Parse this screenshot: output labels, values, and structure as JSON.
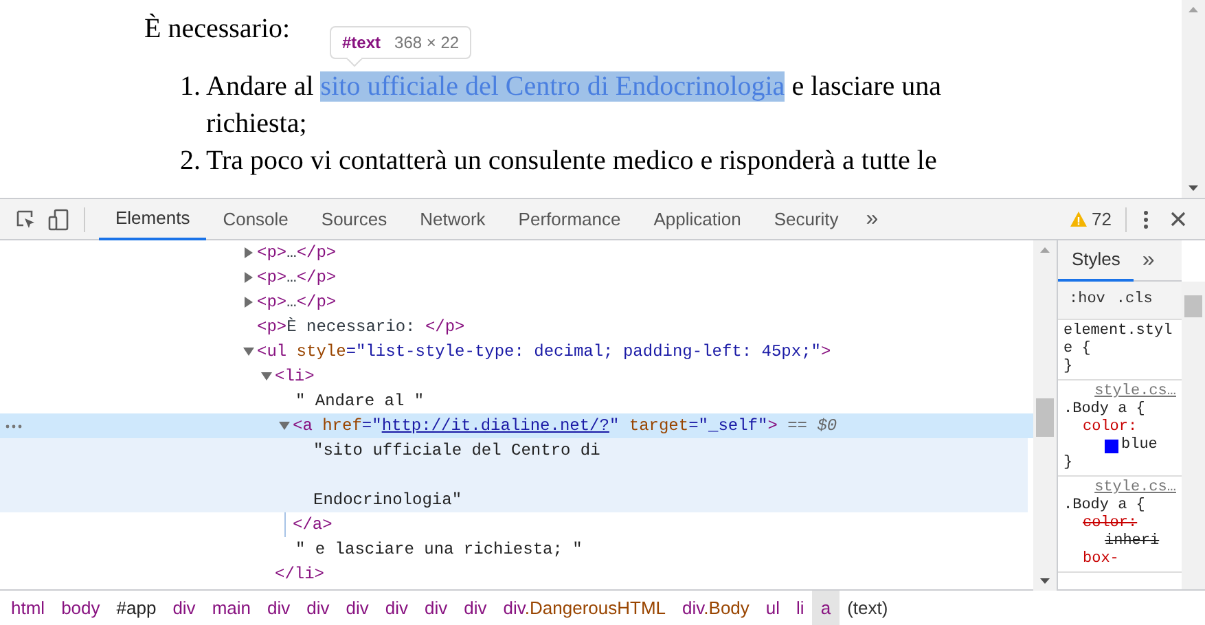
{
  "page": {
    "heading": "È necessario:",
    "list": [
      {
        "number": "1.",
        "before": "Andare al ",
        "link": "sito ufficiale del Centro di Endocrinologia",
        "highlighted": true,
        "after": " e lasciare una richiesta;"
      },
      {
        "number": "2.",
        "before": "Tra poco vi contatterà un consulente medico e risponderà a tutte le"
      }
    ],
    "tooltip": {
      "node": "#text",
      "size": "368 × 22"
    }
  },
  "toolbar": {
    "tabs": [
      {
        "label": "Elements",
        "selected": true
      },
      {
        "label": "Console",
        "selected": false
      },
      {
        "label": "Sources",
        "selected": false
      },
      {
        "label": "Network",
        "selected": false
      },
      {
        "label": "Performance",
        "selected": false
      },
      {
        "label": "Application",
        "selected": false
      },
      {
        "label": "Security",
        "selected": false
      }
    ],
    "more": "»",
    "warnings": "72"
  },
  "dom_tree": [
    {
      "kind": "element",
      "selected": false,
      "expanded": false,
      "tokens": [
        {
          "kind": "tag",
          "text": "<p>"
        },
        {
          "kind": "text",
          "text": "…"
        },
        {
          "kind": "tag",
          "text": "</p>"
        }
      ]
    },
    {
      "kind": "element",
      "selected": false,
      "expanded": false,
      "tokens": [
        {
          "kind": "tag",
          "text": "<p>"
        },
        {
          "kind": "text",
          "text": "…"
        },
        {
          "kind": "tag",
          "text": "</p>"
        }
      ]
    },
    {
      "kind": "element",
      "selected": false,
      "expanded": false,
      "tokens": [
        {
          "kind": "tag",
          "text": "<p>"
        },
        {
          "kind": "text",
          "text": "…"
        },
        {
          "kind": "tag",
          "text": "</p>"
        }
      ]
    },
    {
      "kind": "element",
      "selected": false,
      "tokens": [
        {
          "kind": "tag",
          "text": "<p>"
        },
        {
          "kind": "text",
          "text": "È necessario: "
        },
        {
          "kind": "tag",
          "text": "</p>"
        }
      ]
    },
    {
      "kind": "element",
      "selected": false,
      "expanded": true,
      "tokens": [
        {
          "kind": "tag",
          "text": "<ul"
        },
        {
          "kind": "attr",
          "text": " style"
        },
        {
          "kind": "value",
          "text": "=\"list-style-type: decimal; padding-left: 45px;\""
        },
        {
          "kind": "tag",
          "text": ">"
        }
      ],
      "children": [
        {
          "kind": "element",
          "selected": false,
          "expanded": true,
          "tokens": [
            {
              "kind": "tag",
              "text": "<li>"
            }
          ],
          "close": "</li>",
          "children": [
            {
              "kind": "text",
              "selected": false,
              "tokens": [
                {
                  "kind": "text",
                  "text": "\" Andare al \""
                }
              ]
            },
            {
              "kind": "element",
              "selected": true,
              "expanded": true,
              "suffix": " == $0",
              "tokens": [
                {
                  "kind": "tag",
                  "text": "<a"
                },
                {
                  "kind": "attr",
                  "text": " href"
                },
                {
                  "kind": "value",
                  "text": "=\""
                },
                {
                  "kind": "link",
                  "text": "http://it.dialine.net/?"
                },
                {
                  "kind": "value",
                  "text": "\""
                },
                {
                  "kind": "attr",
                  "text": " target"
                },
                {
                  "kind": "value",
                  "text": "=\"_self\""
                },
                {
                  "kind": "tag",
                  "text": ">"
                }
              ],
              "close": "</a>",
              "children": [
                {
                  "kind": "text",
                  "selected": false,
                  "tokens": [
                    {
                      "kind": "text",
                      "text": "\"sito ufficiale del Centro di\n\nEndocrinologia\""
                    }
                  ]
                }
              ]
            },
            {
              "kind": "text",
              "selected": false,
              "tokens": [
                {
                  "kind": "text",
                  "text": "\" e lasciare una richiesta; \""
                }
              ]
            }
          ]
        }
      ]
    }
  ],
  "styles": {
    "tabs": [
      {
        "label": "Styles",
        "selected": true
      }
    ],
    "more": "»",
    "filters": [
      ":hov",
      ".cls"
    ],
    "rules": [
      {
        "selector": "element.style {",
        "close": "}"
      },
      {
        "source": "style.cs…",
        "selector": ".Body a {",
        "close": "}",
        "properties": [
          {
            "name": "color:",
            "value": "blue",
            "color": "#0000ff",
            "overridden": false
          }
        ]
      },
      {
        "source": "style.cs…",
        "selector": ".Body a {",
        "properties": [
          {
            "name": "color:",
            "value": "inheri",
            "overridden": true
          },
          {
            "name": "box-",
            "overridden": false
          }
        ]
      }
    ]
  },
  "breadcrumb": [
    {
      "kind": "tag",
      "tag": "html",
      "selected": false
    },
    {
      "kind": "tag",
      "tag": "body",
      "selected": false
    },
    {
      "kind": "id",
      "tag": "#app",
      "selected": false
    },
    {
      "kind": "tag",
      "tag": "div",
      "selected": false
    },
    {
      "kind": "tag",
      "tag": "main",
      "selected": false
    },
    {
      "kind": "tag",
      "tag": "div",
      "selected": false
    },
    {
      "kind": "tag",
      "tag": "div",
      "selected": false
    },
    {
      "kind": "tag",
      "tag": "div",
      "selected": false
    },
    {
      "kind": "tag",
      "tag": "div",
      "selected": false
    },
    {
      "kind": "tag",
      "tag": "div",
      "selected": false
    },
    {
      "kind": "tag",
      "tag": "div",
      "selected": false
    },
    {
      "kind": "tag",
      "tag": "div",
      "cls": ".DangerousHTML",
      "selected": false
    },
    {
      "kind": "tag",
      "tag": "div",
      "cls": ".Body",
      "selected": false
    },
    {
      "kind": "tag",
      "tag": "ul",
      "selected": false
    },
    {
      "kind": "tag",
      "tag": "li",
      "selected": false
    },
    {
      "kind": "tag",
      "tag": "a",
      "selected": true
    },
    {
      "kind": "text",
      "tag": "(text)",
      "selected": false
    }
  ]
}
